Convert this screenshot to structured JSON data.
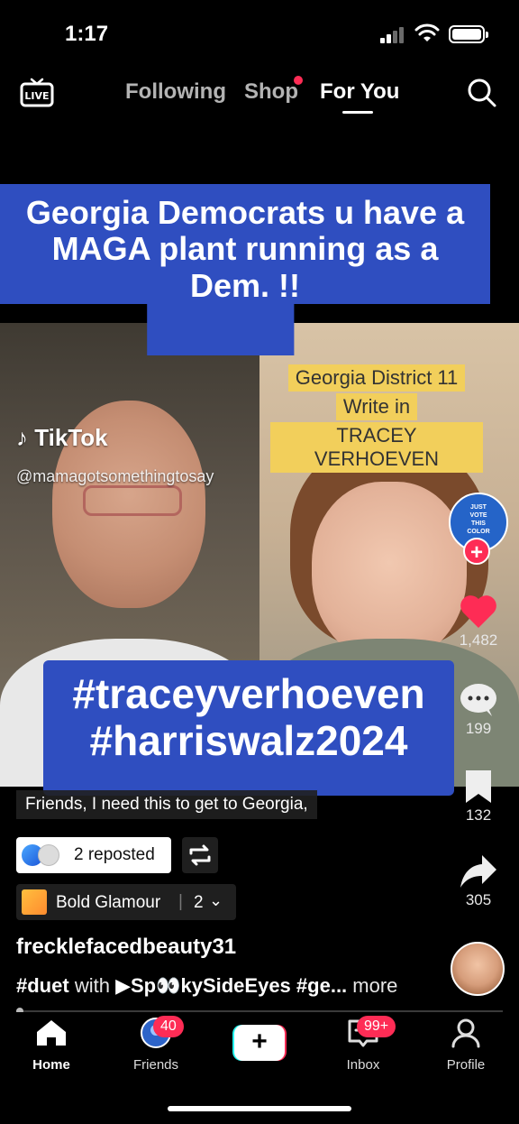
{
  "status_bar": {
    "time": "1:17"
  },
  "top_nav": {
    "live_label": "LIVE",
    "tabs": [
      {
        "label": "Following",
        "active": false
      },
      {
        "label": "Shop",
        "active": false,
        "has_dot": true
      },
      {
        "label": "For You",
        "active": true
      }
    ]
  },
  "video": {
    "caption_top": [
      "Georgia Democrats u have a",
      "MAGA plant running as a",
      "Dem. !!"
    ],
    "caption_bottom": [
      "#traceyverhoeven",
      "#harriswalz2024"
    ],
    "yellow_caption": [
      "Georgia District 11",
      "Write in",
      "TRACEY VERHOEVEN"
    ],
    "watermark": {
      "brand": "TikTok",
      "handle": "@mamagotsomethingtosay"
    }
  },
  "side_actions": {
    "creator_avatar_text": [
      "JUST",
      "VOTE",
      "THIS",
      "COLOR"
    ],
    "likes": "1,482",
    "comments": "199",
    "saves": "132",
    "shares": "305"
  },
  "post_info": {
    "description": "Friends, I need this to get to Georgia,",
    "reposted": "2 reposted",
    "effect": {
      "name": "Bold Glamour",
      "separator": "|",
      "count": "2"
    },
    "username": "frecklefacedbeauty31",
    "caption": {
      "tag": "#duet",
      "with": "with",
      "sound": "▶Sp👀kySideEyes",
      "tag_partial": "#ge...",
      "more": "more"
    }
  },
  "bottom_nav": {
    "items": [
      {
        "label": "Home"
      },
      {
        "label": "Friends",
        "badge": "40"
      },
      {
        "label": "Create"
      },
      {
        "label": "Inbox",
        "badge": "99+"
      },
      {
        "label": "Profile"
      }
    ]
  },
  "colors": {
    "accent": "#fe2c55",
    "caption_blue": "#2f4ec0",
    "yellow": "#f2cf5b"
  }
}
